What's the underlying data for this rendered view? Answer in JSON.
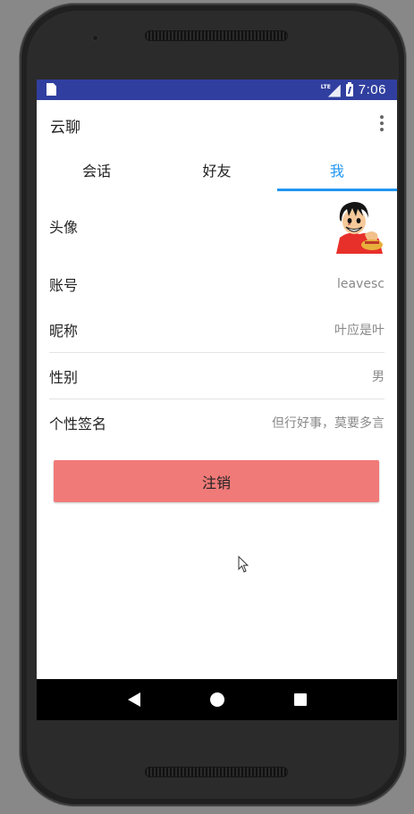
{
  "status_bar": {
    "network_label": "LTE",
    "time": "7:06",
    "background_color": "#303f9f"
  },
  "app_bar": {
    "title": "云聊",
    "overflow_icon": "more-vert-icon"
  },
  "tabs": [
    {
      "label": "会话",
      "active": false
    },
    {
      "label": "好友",
      "active": false
    },
    {
      "label": "我",
      "active": true
    }
  ],
  "accent_color": "#2196f3",
  "profile": {
    "avatar_label": "头像",
    "account_label": "账号",
    "account_value": "leavesc",
    "nickname_label": "昵称",
    "nickname_value": "叶应是叶",
    "gender_label": "性别",
    "gender_value": "男",
    "signature_label": "个性签名",
    "signature_value": "但行好事，莫要多言"
  },
  "logout_button": {
    "label": "注销",
    "color": "#f07a78"
  },
  "nav_bar": {
    "back_icon": "back-triangle-icon",
    "home_icon": "home-circle-icon",
    "recents_icon": "recents-square-icon"
  }
}
